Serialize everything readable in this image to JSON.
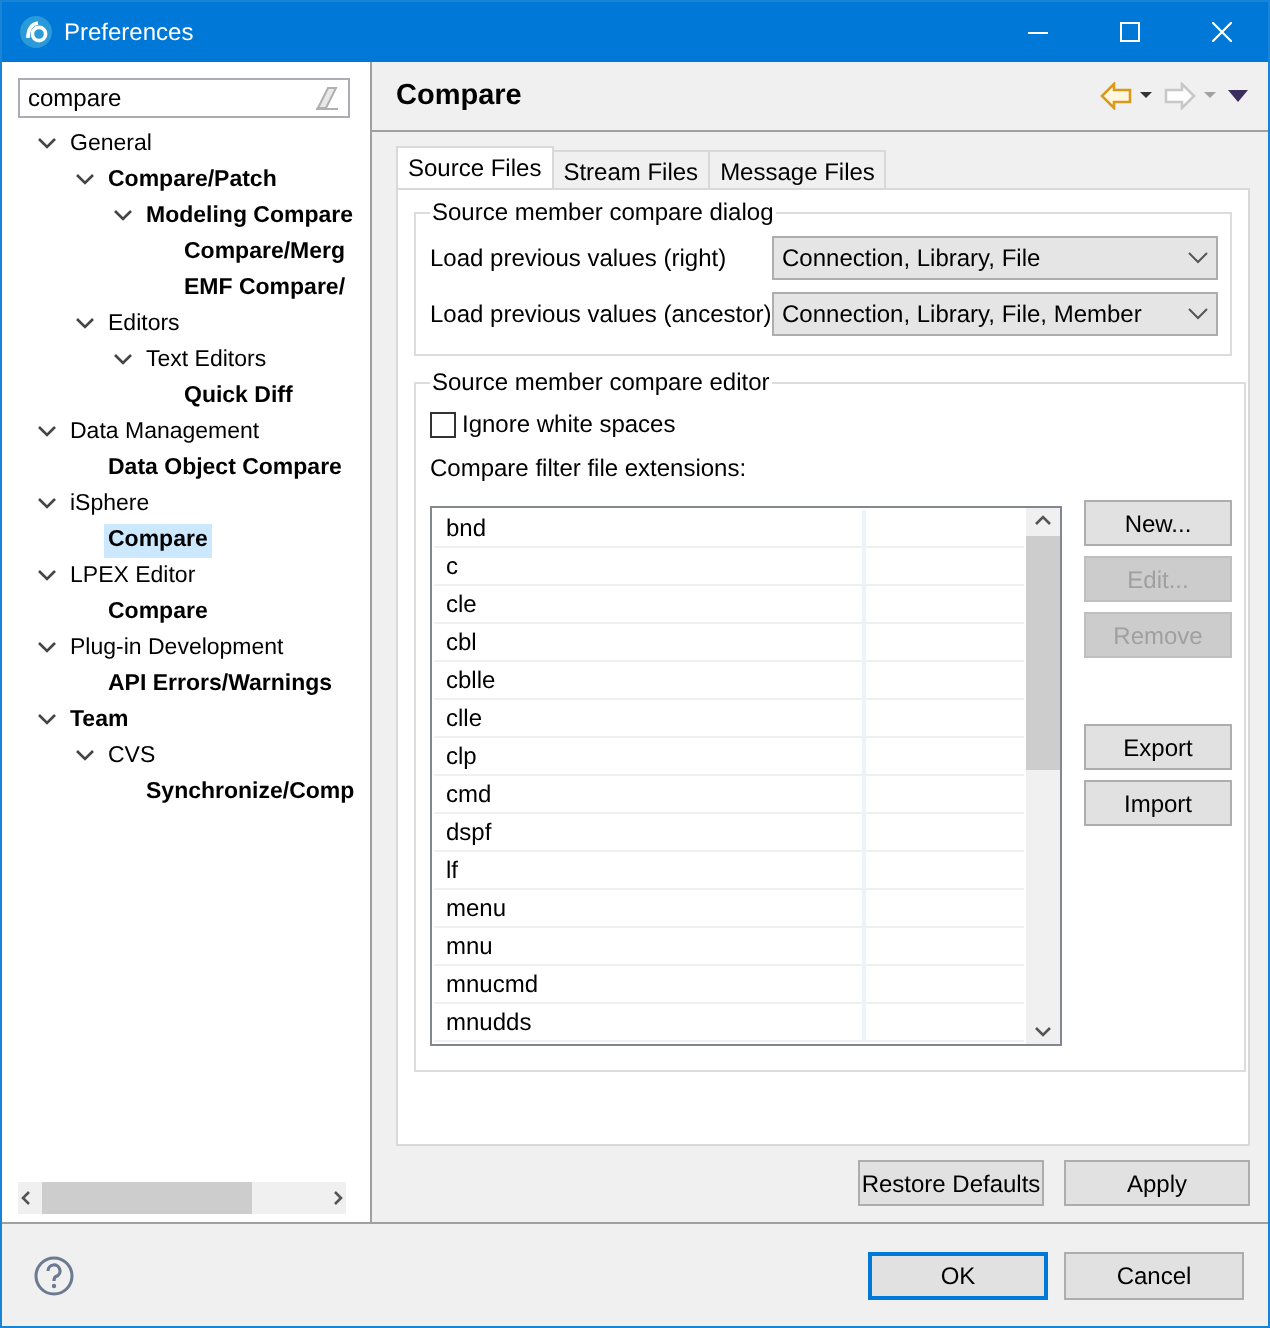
{
  "window": {
    "title": "Preferences",
    "controls": [
      {
        "kind": "minimize"
      },
      {
        "kind": "maximize"
      },
      {
        "kind": "close"
      }
    ]
  },
  "filter": {
    "value": "compare"
  },
  "tree": [
    {
      "label": "General",
      "bold": false,
      "selected": false,
      "expanded": true,
      "children": [
        {
          "label": "Compare/Patch",
          "bold": true,
          "selected": false,
          "expanded": true,
          "children": [
            {
              "label": "Modeling Compare",
              "bold": true,
              "selected": false,
              "expanded": true,
              "children": [
                {
                  "label": "Compare/Merg",
                  "bold": true,
                  "selected": false
                },
                {
                  "label": "EMF Compare/",
                  "bold": true,
                  "selected": false
                }
              ]
            }
          ]
        },
        {
          "label": "Editors",
          "bold": false,
          "selected": false,
          "expanded": true,
          "children": [
            {
              "label": "Text Editors",
              "bold": false,
              "selected": false,
              "expanded": true,
              "children": [
                {
                  "label": "Quick Diff",
                  "bold": true,
                  "selected": false
                }
              ]
            }
          ]
        }
      ]
    },
    {
      "label": "Data Management",
      "bold": false,
      "selected": false,
      "expanded": true,
      "children": [
        {
          "label": "Data Object Compare",
          "bold": true,
          "selected": false
        }
      ]
    },
    {
      "label": "iSphere",
      "bold": false,
      "selected": false,
      "expanded": true,
      "children": [
        {
          "label": "Compare",
          "bold": true,
          "selected": true
        }
      ]
    },
    {
      "label": "LPEX Editor",
      "bold": false,
      "selected": false,
      "expanded": true,
      "children": [
        {
          "label": "Compare",
          "bold": true,
          "selected": false
        }
      ]
    },
    {
      "label": "Plug-in Development",
      "bold": false,
      "selected": false,
      "expanded": true,
      "children": [
        {
          "label": "API Errors/Warnings",
          "bold": true,
          "selected": false
        }
      ]
    },
    {
      "label": "Team",
      "bold": true,
      "selected": false,
      "expanded": true,
      "children": [
        {
          "label": "CVS",
          "bold": false,
          "selected": false,
          "expanded": true,
          "children": [
            {
              "label": "Synchronize/Comp",
              "bold": true,
              "selected": false
            }
          ]
        }
      ]
    }
  ],
  "page": {
    "title": "Compare",
    "toolbar": [
      {
        "kind": "back",
        "disabled": false
      },
      {
        "kind": "forward",
        "disabled": true
      },
      {
        "kind": "menu",
        "disabled": false
      }
    ]
  },
  "tabs": [
    {
      "label": "Source Files",
      "selected": true
    },
    {
      "label": "Stream Files",
      "selected": false
    },
    {
      "label": "Message Files",
      "selected": false
    }
  ],
  "dialog_group": {
    "title": "Source member compare dialog",
    "fields": [
      {
        "label": "Load previous values (right)",
        "value": "Connection, Library, File"
      },
      {
        "label": "Load previous values (ancestor)",
        "value": "Connection, Library, File, Member"
      }
    ]
  },
  "editor_group": {
    "title": "Source member compare editor",
    "ignore_white_spaces": {
      "label": "Ignore white spaces",
      "checked": false
    },
    "extensions_label": "Compare filter file extensions:",
    "extensions": [
      "bnd",
      "c",
      "cle",
      "cbl",
      "cblle",
      "clle",
      "clp",
      "cmd",
      "dspf",
      "lf",
      "menu",
      "mnu",
      "mnucmd",
      "mnudds"
    ],
    "buttons": [
      {
        "label": "New...",
        "disabled": false
      },
      {
        "label": "Edit...",
        "disabled": true
      },
      {
        "label": "Remove",
        "disabled": true
      }
    ],
    "transfer_buttons": [
      {
        "label": "Export",
        "disabled": false
      },
      {
        "label": "Import",
        "disabled": false
      }
    ]
  },
  "page_buttons": [
    {
      "label": "Restore Defaults"
    },
    {
      "label": "Apply"
    }
  ],
  "dialog_buttons": [
    {
      "label": "OK",
      "default": true
    },
    {
      "label": "Cancel",
      "default": false
    }
  ]
}
